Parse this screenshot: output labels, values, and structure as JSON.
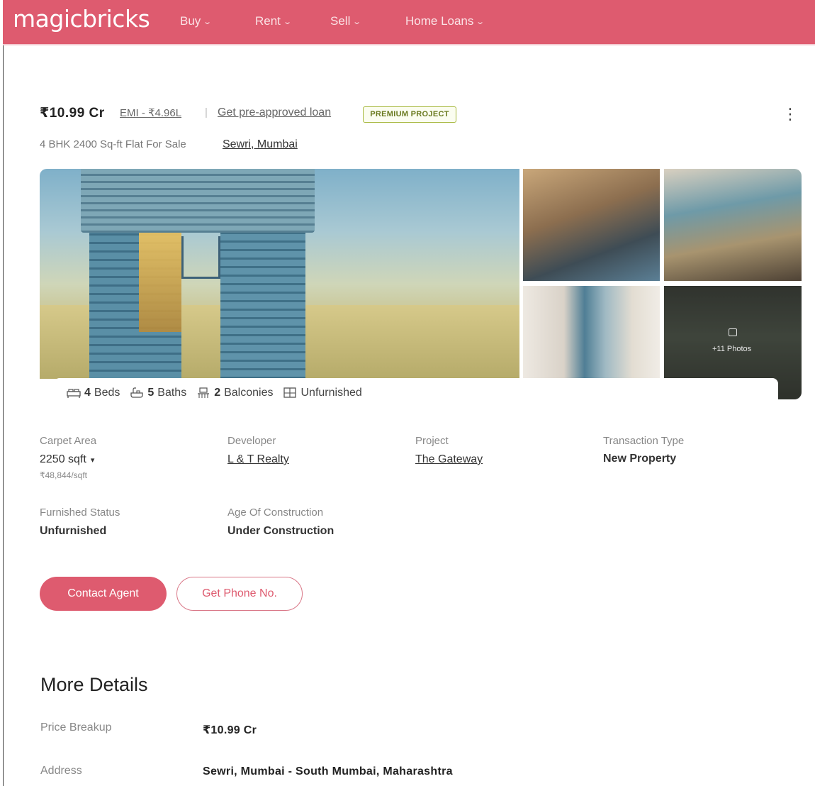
{
  "header": {
    "logo": "magicbricks",
    "nav": [
      {
        "label": "Buy"
      },
      {
        "label": "Rent"
      },
      {
        "label": "Sell"
      },
      {
        "label": "Home Loans"
      }
    ],
    "brand_color": "#de5b6f"
  },
  "listing": {
    "price": "₹10.99 Cr",
    "emi": "EMI - ₹4.96L",
    "separator": "|",
    "loan_link": "Get pre-approved loan",
    "badge": "PREMIUM PROJECT",
    "more_icon": "⋮",
    "subtitle": "4 BHK 2400 Sq-ft Flat For Sale",
    "location": "Sewri, Mumbai"
  },
  "gallery": {
    "photos_label": "+11 Photos"
  },
  "features": [
    {
      "icon": "bed-icon",
      "value": "4",
      "label": "Beds"
    },
    {
      "icon": "bath-icon",
      "value": "5",
      "label": "Baths"
    },
    {
      "icon": "balcony-icon",
      "value": "2",
      "label": "Balconies"
    },
    {
      "icon": "furnishing-icon",
      "value": "",
      "label": "Unfurnished"
    }
  ],
  "summary": {
    "carpet_area_label": "Carpet Area",
    "carpet_area_value": "2250 sqft",
    "carpet_area_rate": "₹48,844/sqft",
    "developer_label": "Developer",
    "developer_value": "L & T Realty",
    "project_label": "Project",
    "project_value": "The Gateway",
    "transaction_label": "Transaction Type",
    "transaction_value": "New Property",
    "furnished_label": "Furnished Status",
    "furnished_value": "Unfurnished",
    "age_label": "Age Of Construction",
    "age_value": "Under Construction"
  },
  "cta": {
    "contact": "Contact Agent",
    "phone": "Get Phone No."
  },
  "more_details": {
    "heading": "More Details",
    "rows": [
      {
        "label": "Price Breakup",
        "value": "₹10.99 Cr"
      },
      {
        "label": "Address",
        "value": "Sewri, Mumbai - South Mumbai, Maharashtra"
      }
    ]
  }
}
